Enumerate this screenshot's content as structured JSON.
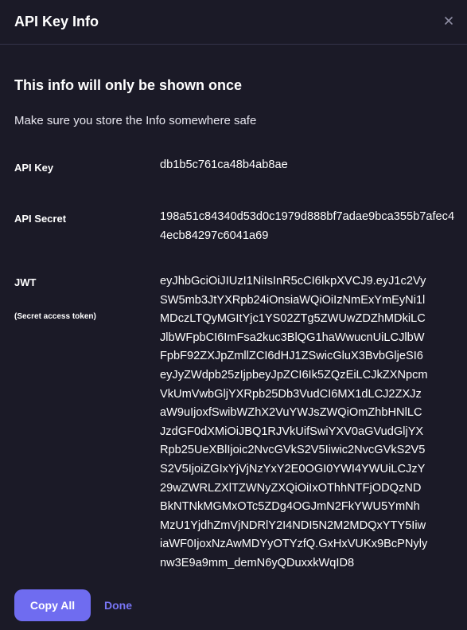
{
  "dialog": {
    "title": "API Key Info",
    "close_icon": "close-icon"
  },
  "notice": {
    "heading": "This info will only be shown once",
    "subtext": "Make sure you store the Info somewhere safe"
  },
  "fields": {
    "api_key": {
      "label": "API Key",
      "value": "db1b5c761ca48b4ab8ae"
    },
    "api_secret": {
      "label": "API Secret",
      "value": "198a51c84340d53d0c1979d888bf7adae9bca355b7afec44ecb84297c6041a69"
    },
    "jwt": {
      "label": "JWT",
      "sublabel": "(Secret access token)",
      "lines": [
        "eyJhbGciOiJIUzI1NiIsInR5cCI6IkpXVCJ9.eyJ1c2Vy",
        "SW5mb3JtYXRpb24iOnsiaWQiOiIzNmExYmEyNi1l",
        "MDczLTQyMGItYjc1YS02ZTg5ZWUwZDZhMDkiLC",
        "JlbWFpbCI6ImFsa2kuc3BlQG1haWwucnUiLCJlbW",
        "FpbF92ZXJpZmllZCI6dHJ1ZSwicGluX3BvbGljeSI6",
        "eyJyZWdpb25zIjpbeyJpZCI6Ik5ZQzEiLCJkZXNpcm",
        "VkUmVwbGljYXRpb25Db3VudCI6MX1dLCJ2ZXJz",
        "aW9uIjoxfSwibWZhX2VuYWJsZWQiOmZhbHNlLC",
        "JzdGF0dXMiOiJBQ1RJVkUifSwiYXV0aGVudGljYX",
        "Rpb25UeXBlIjoic2NvcGVkS2V5Iiwic2NvcGVkS2V5",
        "S2V5IjoiZGIxYjVjNzYxY2E0OGI0YWI4YWUiLCJzY",
        "29wZWRLZXlTZWNyZXQiOiIxOThhNTFjODQzND",
        "BkNTNkMGMxOTc5ZDg4OGJmN2FkYWU5YmNh",
        "MzU1YjdhZmVjNDRlY2I4NDI5N2M2MDQxYTY5Iiw",
        "iaWF0IjoxNzAwMDYyOTYzfQ.GxHxVUKx9BcPNyly",
        "nw3E9a9mm_demN6yQDuxxkWqID8"
      ]
    }
  },
  "actions": {
    "copy_all_label": "Copy All",
    "done_label": "Done"
  },
  "colors": {
    "background": "#1b1a27",
    "accent": "#6f6cf0",
    "link": "#7875f5"
  }
}
